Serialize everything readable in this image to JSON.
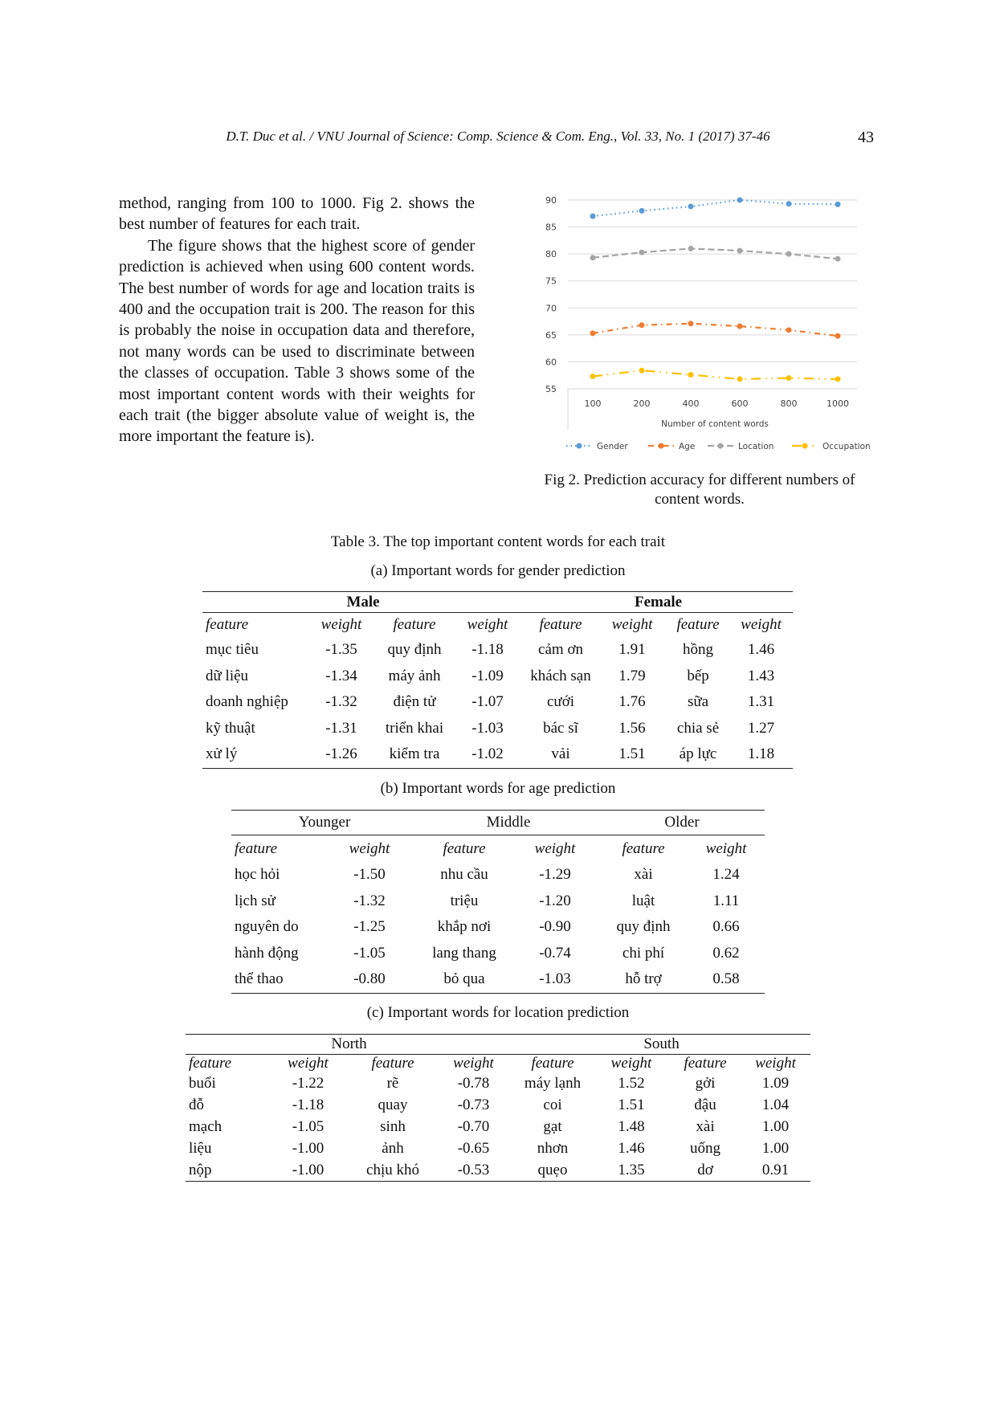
{
  "header": {
    "running_title": "D.T. Duc et al. / VNU Journal of Science: Comp. Science & Com. Eng., Vol. 33, No. 1 (2017) 37-46",
    "page_number": "43"
  },
  "body": {
    "p1": "method, ranging from 100 to 1000. Fig 2. shows the best number of features for each trait.",
    "p2": "The figure shows that the highest score of gender prediction is achieved when using 600 content words. The best number of words for age and location traits is 400 and the occupation trait is 200. The reason for this is probably the noise in occupation data and therefore, not many words can be used to discriminate between the classes of occupation. Table 3 shows some of the most important content words with their weights for each trait (the bigger absolute value of weight is, the more important the feature is)."
  },
  "chart_data": {
    "type": "line",
    "title": "",
    "xlabel": "Number of content words",
    "ylabel": "",
    "categories": [
      "100",
      "200",
      "400",
      "600",
      "800",
      "1000"
    ],
    "ylim": [
      55,
      90
    ],
    "yticks": [
      55,
      60,
      65,
      70,
      75,
      80,
      85,
      90
    ],
    "grid": true,
    "legend": "bottom",
    "series": [
      {
        "name": "Gender",
        "values": [
          87.0,
          88.0,
          88.8,
          90.0,
          89.3,
          89.2
        ],
        "color": "#5b9bd5",
        "dash": "dotted"
      },
      {
        "name": "Age",
        "values": [
          65.3,
          66.8,
          67.1,
          66.6,
          65.9,
          64.8
        ],
        "color": "#ed7d31",
        "dash": "dashdot"
      },
      {
        "name": "Location",
        "values": [
          79.3,
          80.3,
          81.0,
          80.6,
          80.0,
          79.1
        ],
        "color": "#a5a5a5",
        "dash": "dashed"
      },
      {
        "name": "Occupation",
        "values": [
          57.3,
          58.4,
          57.6,
          56.8,
          57.0,
          56.8
        ],
        "color": "#ffc000",
        "dash": "longdashdot"
      }
    ]
  },
  "figure": {
    "caption": "Fig 2. Prediction accuracy for different numbers of content words."
  },
  "table": {
    "title": "Table 3. The top important content words for each trait",
    "col_feature": "feature",
    "col_weight": "weight",
    "a": {
      "subtitle": "(a) Important words for gender prediction",
      "groups": [
        "Male",
        "Female"
      ],
      "rows": [
        [
          "mục tiêu",
          "-1.35",
          "quy định",
          "-1.18",
          "cảm ơn",
          "1.91",
          "hồng",
          "1.46"
        ],
        [
          "dữ liệu",
          "-1.34",
          "máy ảnh",
          "-1.09",
          "khách sạn",
          "1.79",
          "bếp",
          "1.43"
        ],
        [
          "doanh nghiệp",
          "-1.32",
          "điện tử",
          "-1.07",
          "cưới",
          "1.76",
          "sữa",
          "1.31"
        ],
        [
          "kỹ thuật",
          "-1.31",
          "triển khai",
          "-1.03",
          "bác sĩ",
          "1.56",
          "chia sẻ",
          "1.27"
        ],
        [
          "xử lý",
          "-1.26",
          "kiểm tra",
          "-1.02",
          "vải",
          "1.51",
          "áp lực",
          "1.18"
        ]
      ]
    },
    "b": {
      "subtitle": "(b) Important words for age prediction",
      "groups": [
        "Younger",
        "Middle",
        "Older"
      ],
      "rows": [
        [
          "học hỏi",
          "-1.50",
          "nhu cầu",
          "-1.29",
          "xài",
          "1.24"
        ],
        [
          "lịch sử",
          "-1.32",
          "triệu",
          "-1.20",
          "luật",
          "1.11"
        ],
        [
          "nguyên do",
          "-1.25",
          "khắp  nơi",
          "-0.90",
          "quy định",
          "0.66"
        ],
        [
          "hành động",
          "-1.05",
          "lang thang",
          "-0.74",
          "chi phí",
          "0.62"
        ],
        [
          "thể thao",
          "-0.80",
          "bỏ qua",
          "-1.03",
          "hỗ trợ",
          "0.58"
        ]
      ]
    },
    "c": {
      "subtitle": "(c) Important words for location prediction",
      "groups": [
        "North",
        "South"
      ],
      "rows": [
        [
          "buổi",
          "-1.22",
          "rẽ",
          "-0.78",
          "máy lạnh",
          "1.52",
          "gởi",
          "1.09"
        ],
        [
          "đỗ",
          "-1.18",
          "quay",
          "-0.73",
          "coi",
          "1.51",
          "đậu",
          "1.04"
        ],
        [
          "mạch",
          "-1.05",
          "sinh",
          "-0.70",
          "gạt",
          "1.48",
          "xài",
          "1.00"
        ],
        [
          "liệu",
          "-1.00",
          "ảnh",
          "-0.65",
          "nhơn",
          "1.46",
          "uống",
          "1.00"
        ],
        [
          "nộp",
          "-1.00",
          "chịu khó",
          "-0.53",
          "quẹo",
          "1.35",
          "dơ",
          "0.91"
        ]
      ]
    }
  }
}
